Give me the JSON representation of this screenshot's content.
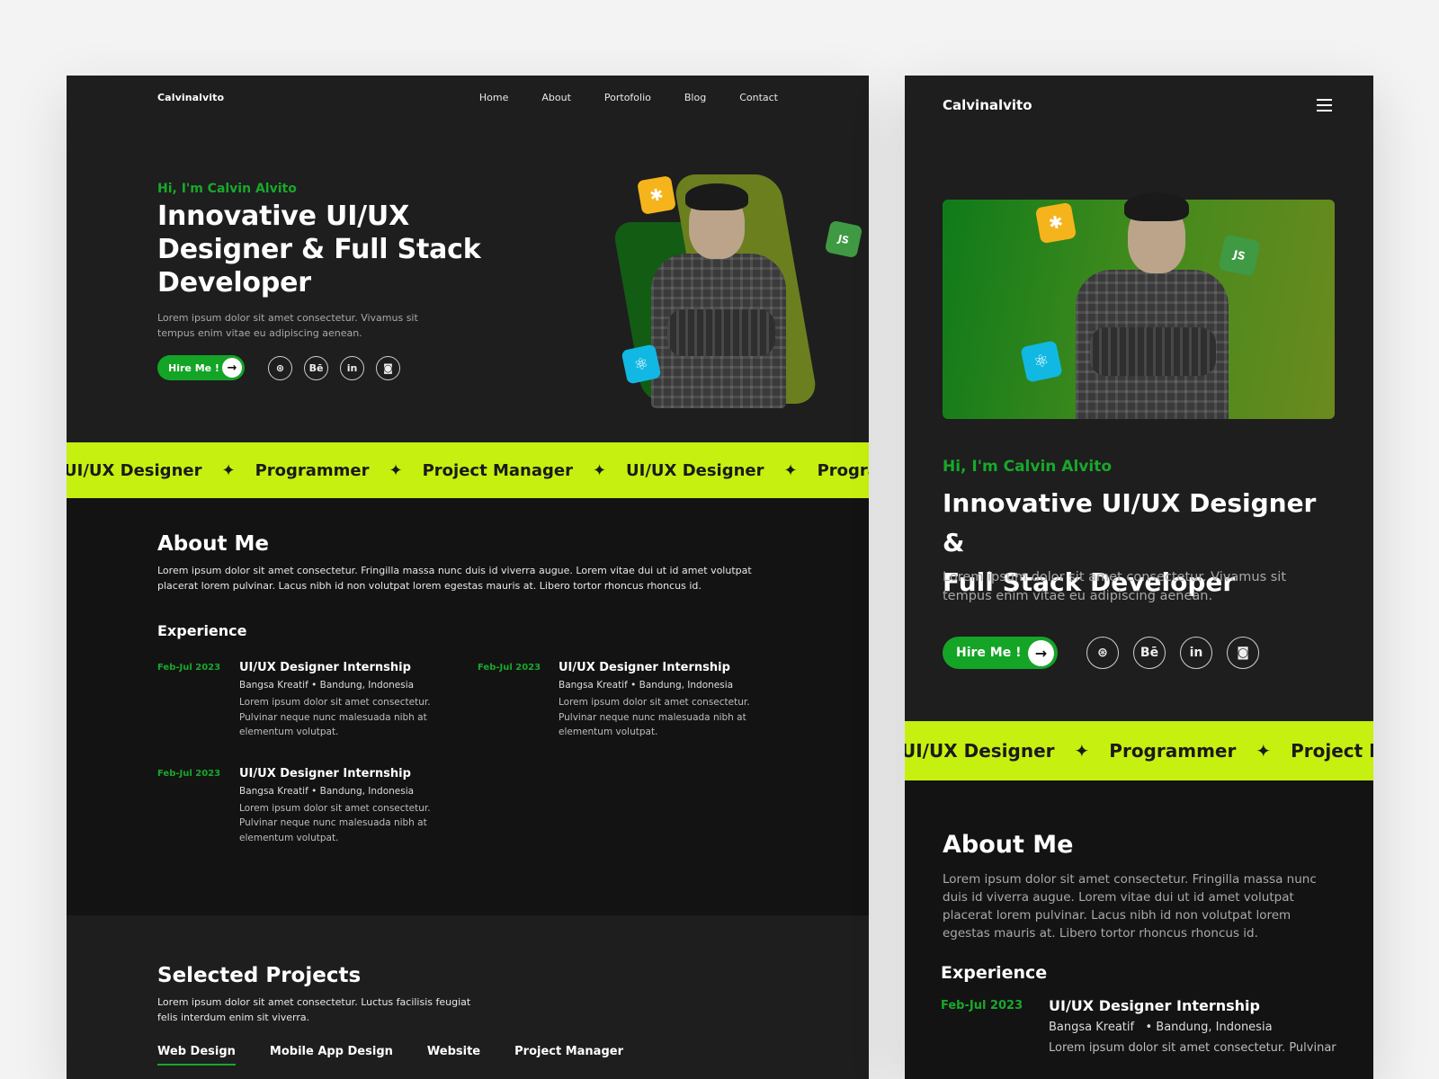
{
  "brand": "Calvinalvito",
  "nav": [
    "Home",
    "About",
    "Portofolio",
    "Blog",
    "Contact"
  ],
  "hero": {
    "greeting": "Hi, I'm Calvin Alvito",
    "title_desktop_lines": [
      "Innovative UI/UX",
      "Designer & Full Stack",
      "Developer"
    ],
    "title_mobile_lines": [
      "Innovative UI/UX Designer &",
      "Full Stack Developer"
    ],
    "subtitle": "Lorem ipsum dolor sit amet consectetur. Vivamus sit tempus enim vitae eu adipiscing aenean.",
    "cta": "Hire Me !",
    "socials": [
      "dribbble-icon",
      "behance-icon",
      "linkedin-icon",
      "instagram-icon"
    ],
    "tech_badges": [
      "slack-icon",
      "nodejs-icon",
      "react-icon"
    ]
  },
  "marquee": {
    "desktop": [
      "UI/UX Designer",
      "Programmer",
      "Project Manager",
      "UI/UX Designer",
      "Programmer"
    ],
    "mobile": [
      "UI/UX Designer",
      "Programmer",
      "Project Manager"
    ]
  },
  "about": {
    "heading": "About Me",
    "text": "Lorem ipsum dolor sit amet consectetur. Fringilla massa nunc duis id viverra augue. Lorem vitae dui ut id amet volutpat placerat lorem pulvinar. Lacus nibh id non volutpat lorem egestas mauris at. Libero tortor rhoncus rhoncus id."
  },
  "experience": {
    "heading": "Experience",
    "items": [
      {
        "date": "Feb-Jul 2023",
        "title": "UI/UX Designer Internship",
        "company": "Bangsa Kreatif",
        "location": "Bandung, Indonesia",
        "desc": "Lorem ipsum dolor sit amet consectetur. Pulvinar neque nunc malesuada nibh at elementum volutpat."
      },
      {
        "date": "Feb-Jul 2023",
        "title": "UI/UX Designer Internship",
        "company": "Bangsa Kreatif",
        "location": "Bandung, Indonesia",
        "desc": "Lorem ipsum dolor sit amet consectetur. Pulvinar neque nunc malesuada nibh at elementum volutpat."
      },
      {
        "date": "Feb-Jul 2023",
        "title": "UI/UX Designer Internship",
        "company": "Bangsa Kreatif",
        "location": "Bandung, Indonesia",
        "desc": "Lorem ipsum dolor sit amet consectetur. Pulvinar neque nunc malesuada nibh at elementum volutpat."
      }
    ],
    "mobile_desc_visible": "Lorem ipsum dolor sit amet consectetur. Pulvinar"
  },
  "projects": {
    "heading": "Selected Projects",
    "text": "Lorem ipsum dolor sit amet consectetur. Luctus facilisis feugiat felis interdum enim sit viverra.",
    "tabs": [
      "Web Design",
      "Mobile App Design",
      "Website",
      "Project Manager"
    ],
    "active_tab": "Web Design"
  },
  "colors": {
    "accent_green": "#18a82a",
    "lime": "#c6f00f",
    "panel": "#1e1e1e",
    "panel_dark": "#131313"
  }
}
